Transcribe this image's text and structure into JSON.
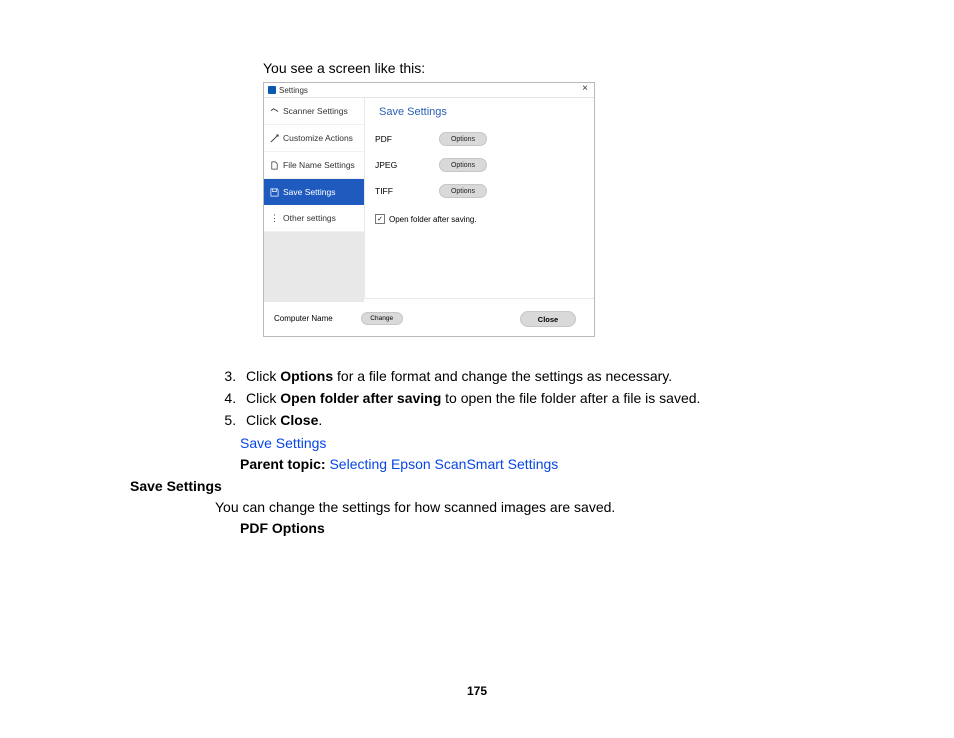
{
  "intro": "You see a screen like this:",
  "screenshot": {
    "window_title": "Settings",
    "close_glyph": "×",
    "sidebar": {
      "items": [
        {
          "label": "Scanner Settings"
        },
        {
          "label": "Customize Actions"
        },
        {
          "label": "File Name Settings"
        },
        {
          "label": "Save Settings"
        },
        {
          "label": "Other settings"
        }
      ]
    },
    "main": {
      "title": "Save Settings",
      "rows": [
        {
          "label": "PDF",
          "button": "Options"
        },
        {
          "label": "JPEG",
          "button": "Options"
        },
        {
          "label": "TIFF",
          "button": "Options"
        }
      ],
      "checkbox_label": "Open folder after saving."
    },
    "footer": {
      "computer_label": "Computer Name",
      "change_button": "Change",
      "close_button": "Close"
    }
  },
  "steps": {
    "s3_a": "Click ",
    "s3_b": "Options",
    "s3_c": " for a file format and change the settings as necessary.",
    "s4_a": "Click ",
    "s4_b": "Open folder after saving",
    "s4_c": " to open the file folder after a file is saved.",
    "s5_a": "Click ",
    "s5_b": "Close",
    "s5_c": "."
  },
  "related_link": "Save Settings",
  "parent_label": "Parent topic: ",
  "parent_link": "Selecting Epson ScanSmart Settings",
  "section_heading": "Save Settings",
  "section_body": "You can change the settings for how scanned images are saved.",
  "subheading": "PDF Options",
  "page_number": "175"
}
